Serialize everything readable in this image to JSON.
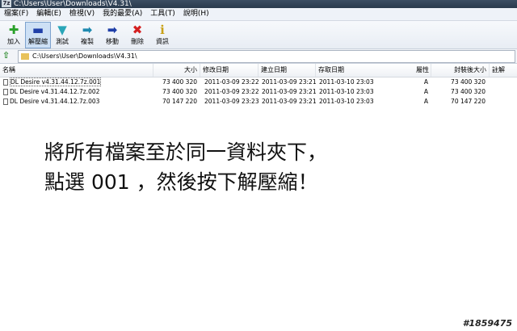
{
  "window": {
    "title": "C:\\Users\\User\\Downloads\\V4.31\\"
  },
  "menu": [
    "檔案(F)",
    "編輯(E)",
    "檢視(V)",
    "我的最愛(A)",
    "工具(T)",
    "說明(H)"
  ],
  "toolbar": [
    {
      "label": "加入",
      "icon": "plus-icon",
      "glyph": "✚",
      "color": "#2aa12a"
    },
    {
      "label": "解壓縮",
      "icon": "minus-icon",
      "glyph": "▬",
      "color": "#1f3fa8",
      "pressed": true
    },
    {
      "label": "測試",
      "icon": "check-icon",
      "glyph": "▼",
      "color": "#2aa6b8"
    },
    {
      "label": "複製",
      "icon": "copy-arrow-icon",
      "glyph": "➡",
      "color": "#1f8ab0"
    },
    {
      "label": "移動",
      "icon": "move-arrow-icon",
      "glyph": "➡",
      "color": "#1f3fa8"
    },
    {
      "label": "刪除",
      "icon": "delete-icon",
      "glyph": "✖",
      "color": "#d42020"
    },
    {
      "label": "資訊",
      "icon": "info-icon",
      "glyph": "ℹ",
      "color": "#c9a116"
    }
  ],
  "address": {
    "path": "C:\\Users\\User\\Downloads\\V4.31\\"
  },
  "columns": {
    "name": "名稱",
    "size": "大小",
    "modified": "修改日期",
    "created": "建立日期",
    "accessed": "存取日期",
    "attributes": "屬性",
    "packed": "封裝後大小",
    "comment": "註解"
  },
  "files": [
    {
      "name": "DL Desire v4.31.44.12.7z.001",
      "size": "73 400 320",
      "modified": "2011-03-09 23:22",
      "created": "2011-03-09 23:21",
      "accessed": "2011-03-10 23:03",
      "attributes": "A",
      "packed": "73 400 320"
    },
    {
      "name": "DL Desire v4.31.44.12.7z.002",
      "size": "73 400 320",
      "modified": "2011-03-09 23:22",
      "created": "2011-03-09 23:21",
      "accessed": "2011-03-10 23:03",
      "attributes": "A",
      "packed": "73 400 320"
    },
    {
      "name": "DL Desire v4.31.44.12.7z.003",
      "size": "70 147 220",
      "modified": "2011-03-09 23:23",
      "created": "2011-03-09 23:21",
      "accessed": "2011-03-10 23:03",
      "attributes": "A",
      "packed": "70 147 220"
    }
  ],
  "annotation": {
    "line1": "將所有檔案至於同一資料夾下，",
    "line2": "點選 001 ，然後按下解壓縮！"
  },
  "watermark": "#1859475"
}
